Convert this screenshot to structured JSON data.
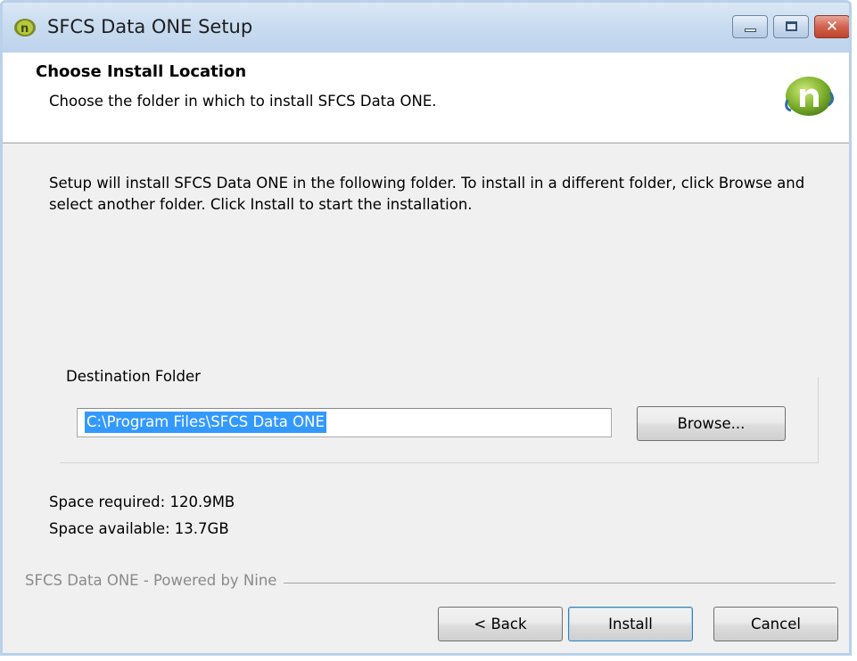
{
  "window": {
    "title": "SFCS Data ONE Setup",
    "icon": "app-icon",
    "caption_buttons": [
      "minimize-icon",
      "maximize-icon",
      "close-icon"
    ],
    "close_glyph": "✕"
  },
  "header": {
    "title": "Choose Install Location",
    "subtitle": "Choose the folder in which to install SFCS Data ONE.",
    "logo_icon": "n-logo-icon"
  },
  "body": {
    "instructions": "Setup will install SFCS Data ONE in the following folder. To install in a different folder, click Browse and select another folder. Click Install to start the installation.",
    "destination": {
      "group_label": "Destination Folder",
      "path_value": "C:\\Program Files\\SFCS Data ONE",
      "browse_label": "Browse..."
    },
    "space_required": "Space required: 120.9MB",
    "space_available": "Space available: 13.7GB"
  },
  "footer": {
    "branding": "SFCS Data ONE - Powered by Nine",
    "back_label": "< Back",
    "install_label": "Install",
    "cancel_label": "Cancel"
  },
  "colors": {
    "titlebar": "#c9dcf0",
    "selection": "#3399ff",
    "close_button": "#c0432d",
    "logo_green": "#6aa728"
  }
}
